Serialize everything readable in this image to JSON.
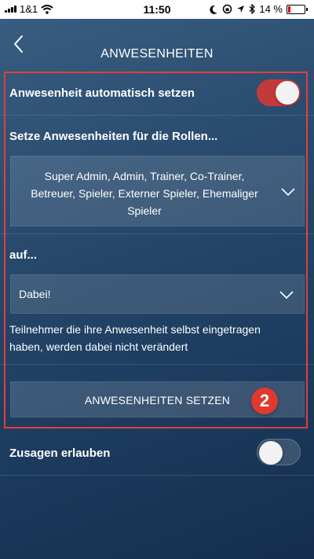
{
  "status_bar": {
    "carrier": "1&1",
    "time": "11:50",
    "battery": "14 %",
    "battery_level": 0.14
  },
  "header": {
    "back_icon": "chevron-left-icon",
    "title": "ANWESENHEITEN"
  },
  "auto_presence": {
    "label": "Anwesenheit automatisch setzen",
    "enabled": true
  },
  "roles": {
    "heading": "Setze Anwesenheiten für die Rollen...",
    "selected_line1": "Super Admin, Admin, Trainer, Co-Trainer,",
    "selected_line2": "Betreuer, Spieler, Externer Spieler, Ehemaliger",
    "selected_line3": "Spieler"
  },
  "status": {
    "heading": "auf...",
    "selected": "Dabei!"
  },
  "info": {
    "line1": "Teilnehmer die ihre Anwesenheit selbst eingetragen",
    "line2": "haben, werden dabei nicht verändert"
  },
  "actions": {
    "set_presence_label": "ANWESENHEITEN SETZEN",
    "annotation_number": "2"
  },
  "allow_commitments": {
    "label": "Zusagen erlauben",
    "enabled": false
  },
  "colors": {
    "toggle_on": "#c23a3a",
    "highlight": "#e0403a",
    "badge": "#e03a2e"
  }
}
